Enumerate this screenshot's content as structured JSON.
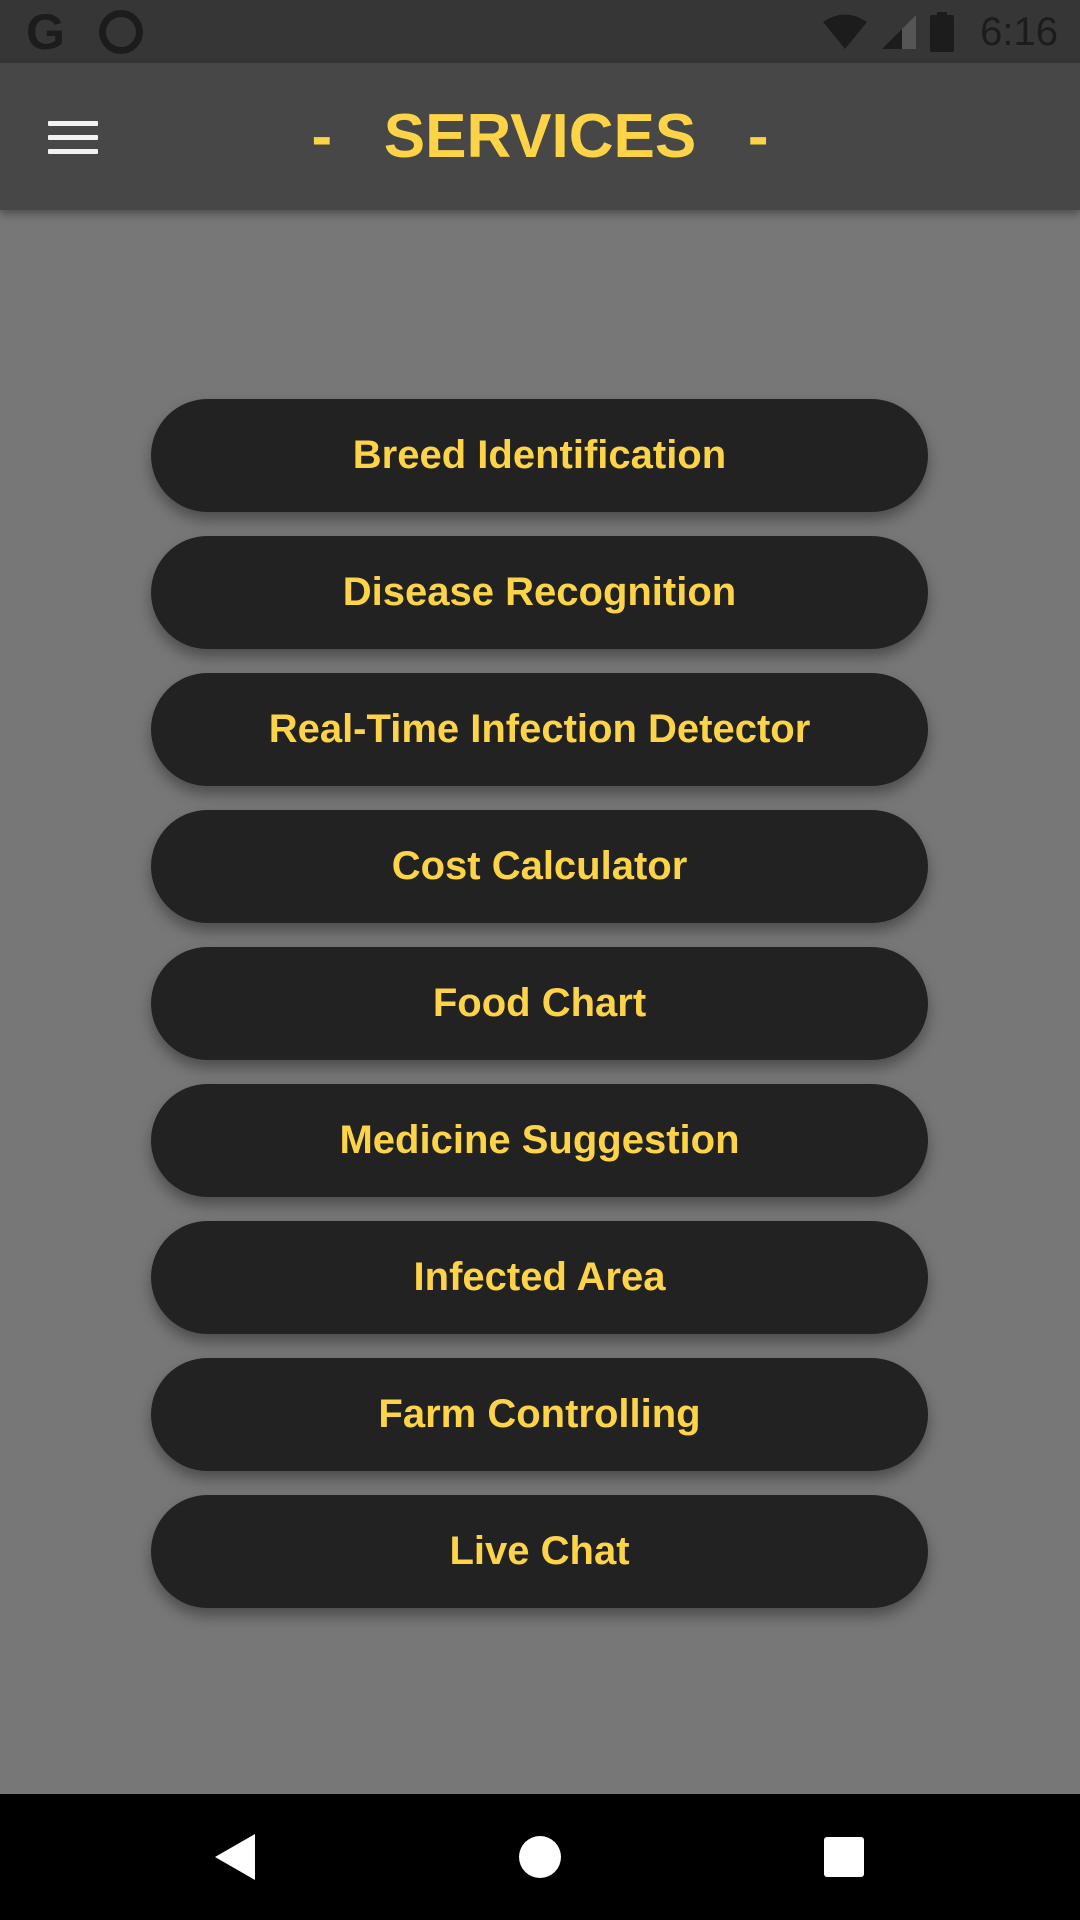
{
  "status_bar": {
    "time": "6:16",
    "icons": [
      "google-icon",
      "circle-notification-icon",
      "wifi-icon",
      "signal-icon",
      "battery-icon"
    ]
  },
  "app_bar": {
    "title": "-   SERVICES   -",
    "menu_icon": "hamburger-menu-icon"
  },
  "services": {
    "items": [
      {
        "label": "Breed Identification"
      },
      {
        "label": "Disease Recognition"
      },
      {
        "label": "Real-Time Infection Detector"
      },
      {
        "label": "Cost Calculator"
      },
      {
        "label": "Food Chart"
      },
      {
        "label": "Medicine Suggestion"
      },
      {
        "label": "Infected Area"
      },
      {
        "label": "Farm Controlling"
      },
      {
        "label": "Live Chat"
      }
    ]
  },
  "nav_bar": {
    "icons": [
      "back-icon",
      "home-icon",
      "recents-icon"
    ]
  },
  "colors": {
    "background": "#777777",
    "app_bar": "#474747",
    "status_bar": "#363636",
    "button": "#222222",
    "accent_text": "#fdd447"
  }
}
